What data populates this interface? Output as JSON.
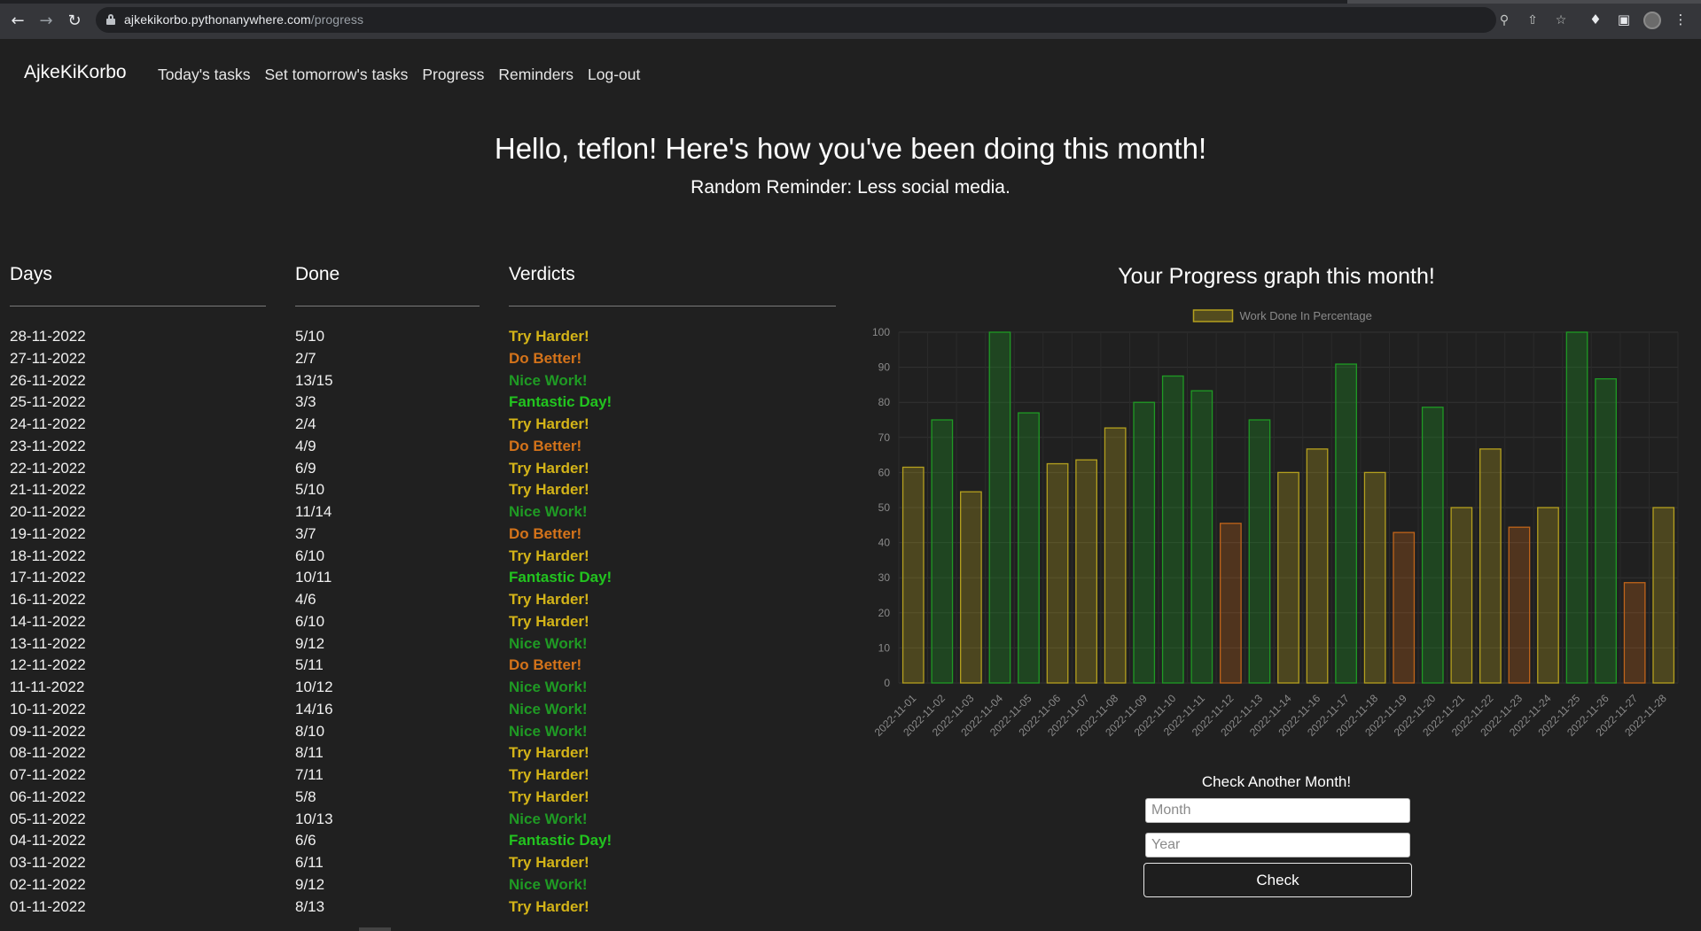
{
  "browser": {
    "url_host": "ajkekikorbo.pythonanywhere.com",
    "url_path": "/progress"
  },
  "navbar": {
    "brand": "AjkeKiKorbo",
    "links": [
      "Today's tasks",
      "Set tomorrow's tasks",
      "Progress",
      "Reminders",
      "Log-out"
    ]
  },
  "header": {
    "greeting": "Hello, teflon! Here's how you've been doing this month!",
    "reminder": "Random Reminder: Less social media."
  },
  "table": {
    "headers": [
      "Days",
      "Done",
      "Verdicts"
    ],
    "rows": [
      {
        "day": "28-11-2022",
        "done": "5/10",
        "verdict": "Try Harder!"
      },
      {
        "day": "27-11-2022",
        "done": "2/7",
        "verdict": "Do Better!"
      },
      {
        "day": "26-11-2022",
        "done": "13/15",
        "verdict": "Nice Work!"
      },
      {
        "day": "25-11-2022",
        "done": "3/3",
        "verdict": "Fantastic Day!"
      },
      {
        "day": "24-11-2022",
        "done": "2/4",
        "verdict": "Try Harder!"
      },
      {
        "day": "23-11-2022",
        "done": "4/9",
        "verdict": "Do Better!"
      },
      {
        "day": "22-11-2022",
        "done": "6/9",
        "verdict": "Try Harder!"
      },
      {
        "day": "21-11-2022",
        "done": "5/10",
        "verdict": "Try Harder!"
      },
      {
        "day": "20-11-2022",
        "done": "11/14",
        "verdict": "Nice Work!"
      },
      {
        "day": "19-11-2022",
        "done": "3/7",
        "verdict": "Do Better!"
      },
      {
        "day": "18-11-2022",
        "done": "6/10",
        "verdict": "Try Harder!"
      },
      {
        "day": "17-11-2022",
        "done": "10/11",
        "verdict": "Fantastic Day!"
      },
      {
        "day": "16-11-2022",
        "done": "4/6",
        "verdict": "Try Harder!"
      },
      {
        "day": "14-11-2022",
        "done": "6/10",
        "verdict": "Try Harder!"
      },
      {
        "day": "13-11-2022",
        "done": "9/12",
        "verdict": "Nice Work!"
      },
      {
        "day": "12-11-2022",
        "done": "5/11",
        "verdict": "Do Better!"
      },
      {
        "day": "11-11-2022",
        "done": "10/12",
        "verdict": "Nice Work!"
      },
      {
        "day": "10-11-2022",
        "done": "14/16",
        "verdict": "Nice Work!"
      },
      {
        "day": "09-11-2022",
        "done": "8/10",
        "verdict": "Nice Work!"
      },
      {
        "day": "08-11-2022",
        "done": "8/11",
        "verdict": "Try Harder!"
      },
      {
        "day": "07-11-2022",
        "done": "7/11",
        "verdict": "Try Harder!"
      },
      {
        "day": "06-11-2022",
        "done": "5/8",
        "verdict": "Try Harder!"
      },
      {
        "day": "05-11-2022",
        "done": "10/13",
        "verdict": "Nice Work!"
      },
      {
        "day": "04-11-2022",
        "done": "6/6",
        "verdict": "Fantastic Day!"
      },
      {
        "day": "03-11-2022",
        "done": "6/11",
        "verdict": "Try Harder!"
      },
      {
        "day": "02-11-2022",
        "done": "9/12",
        "verdict": "Nice Work!"
      },
      {
        "day": "01-11-2022",
        "done": "8/13",
        "verdict": "Try Harder!"
      }
    ]
  },
  "verdict_colors": {
    "Try Harder!": "#d4b418",
    "Do Better!": "#d4731a",
    "Nice Work!": "#1f9a24",
    "Fantastic Day!": "#22c41f"
  },
  "chart_title": "Your Progress graph this month!",
  "chart_data": {
    "type": "bar",
    "title": "Your Progress graph this month!",
    "legend": {
      "label": "Work Done In Percentage",
      "position": "top-center"
    },
    "categories": [
      "2022-11-01",
      "2022-11-02",
      "2022-11-03",
      "2022-11-04",
      "2022-11-05",
      "2022-11-06",
      "2022-11-07",
      "2022-11-08",
      "2022-11-09",
      "2022-11-10",
      "2022-11-11",
      "2022-11-12",
      "2022-11-13",
      "2022-11-14",
      "2022-11-16",
      "2022-11-17",
      "2022-11-18",
      "2022-11-19",
      "2022-11-20",
      "2022-11-21",
      "2022-11-22",
      "2022-11-23",
      "2022-11-24",
      "2022-11-25",
      "2022-11-26",
      "2022-11-27",
      "2022-11-28"
    ],
    "values": [
      61.5,
      75,
      54.5,
      100,
      77,
      62.5,
      63.6,
      72.7,
      80,
      87.5,
      83.3,
      45.5,
      75,
      60,
      66.7,
      90.9,
      60,
      42.9,
      78.6,
      50,
      66.7,
      44.4,
      50,
      100,
      86.7,
      28.6,
      50
    ],
    "ylim": [
      0,
      100
    ],
    "yticks": [
      0,
      10,
      20,
      30,
      40,
      50,
      60,
      70,
      80,
      90,
      100
    ],
    "grid": true,
    "colors": {
      "green": "#1f9a24",
      "yellow": "#b4a01e",
      "orange": "#c0641a"
    }
  },
  "form": {
    "title": "Check Another Month!",
    "month_placeholder": "Month",
    "year_placeholder": "Year",
    "button_label": "Check"
  }
}
